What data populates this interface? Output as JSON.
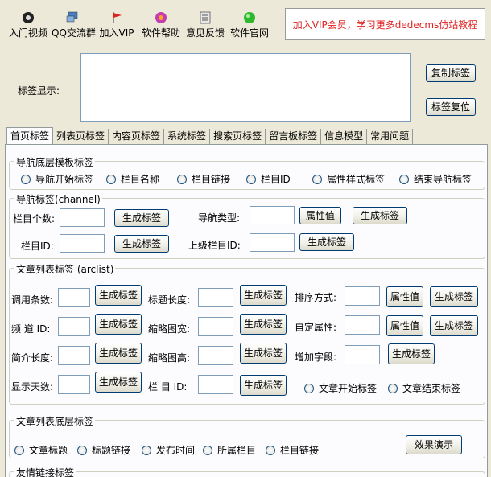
{
  "toolbar": {
    "items": [
      {
        "label": "入门视频",
        "icon": "video-icon"
      },
      {
        "label": "QQ交流群",
        "icon": "qq-group-icon"
      },
      {
        "label": "加入VIP",
        "icon": "flag-icon"
      },
      {
        "label": "软件帮助",
        "icon": "help-icon"
      },
      {
        "label": "意见反馈",
        "icon": "feedback-icon"
      },
      {
        "label": "软件官网",
        "icon": "website-icon"
      }
    ],
    "vip_banner": "加入VIP会员，学习更多dedecms仿站教程"
  },
  "tag_display": {
    "label": "标签显示:",
    "value": "",
    "copy_button": "复制标签",
    "reset_button": "标签复位"
  },
  "tabs": [
    "首页标签",
    "列表页标签",
    "内容页标签",
    "系统标签",
    "搜索页标签",
    "留言板标签",
    "信息模型",
    "常用问题"
  ],
  "nav_bottom": {
    "title": "导航底层模板标签",
    "options": [
      "导航开始标签",
      "栏目名称",
      "栏目链接",
      "栏目ID",
      "属性样式标签",
      "结束导航标签"
    ]
  },
  "channel": {
    "title": "导航标签(channel)",
    "count_label": "栏目个数:",
    "count_value": "",
    "gen_button": "生成标签",
    "type_label": "导航类型:",
    "type_value": "",
    "attr_button": "属性值",
    "gen_button2": "生成标签",
    "id_label": "栏目ID:",
    "id_value": "",
    "gen_button3": "生成标签",
    "parent_label": "上级栏目ID:",
    "parent_value": "",
    "gen_button4": "生成标签"
  },
  "arclist": {
    "title": "文章列表标签 (arclist)",
    "rows": [
      {
        "label1": "调用条数:",
        "label2": "标题长度:",
        "label3": "排序方式:",
        "attr3": "属性值"
      },
      {
        "label1": "频 道 ID:",
        "label2": "缩略图宽:",
        "label3": "自定属性:",
        "attr3": "属性值"
      },
      {
        "label1": "简介长度:",
        "label2": "缩略图高:",
        "label3": "增加字段:",
        "attr3": ""
      },
      {
        "label1": "显示天数:",
        "label2": "栏 目 ID:",
        "label3": "",
        "attr3": ""
      }
    ],
    "gen_button": "生成标签",
    "start_tag": "文章开始标签",
    "end_tag": "文章结束标签"
  },
  "arclist_bottom": {
    "title": "文章列表底层标签",
    "options": [
      "文章标题",
      "标题链接",
      "发布时间",
      "所属栏目",
      "栏目链接"
    ],
    "demo_button": "效果演示"
  },
  "friendlink": {
    "title": "友情链接标签"
  },
  "colors": {
    "banner_text": "#e02020",
    "panel_bg": "#fcfcfe",
    "window_bg": "#ece9d8"
  }
}
